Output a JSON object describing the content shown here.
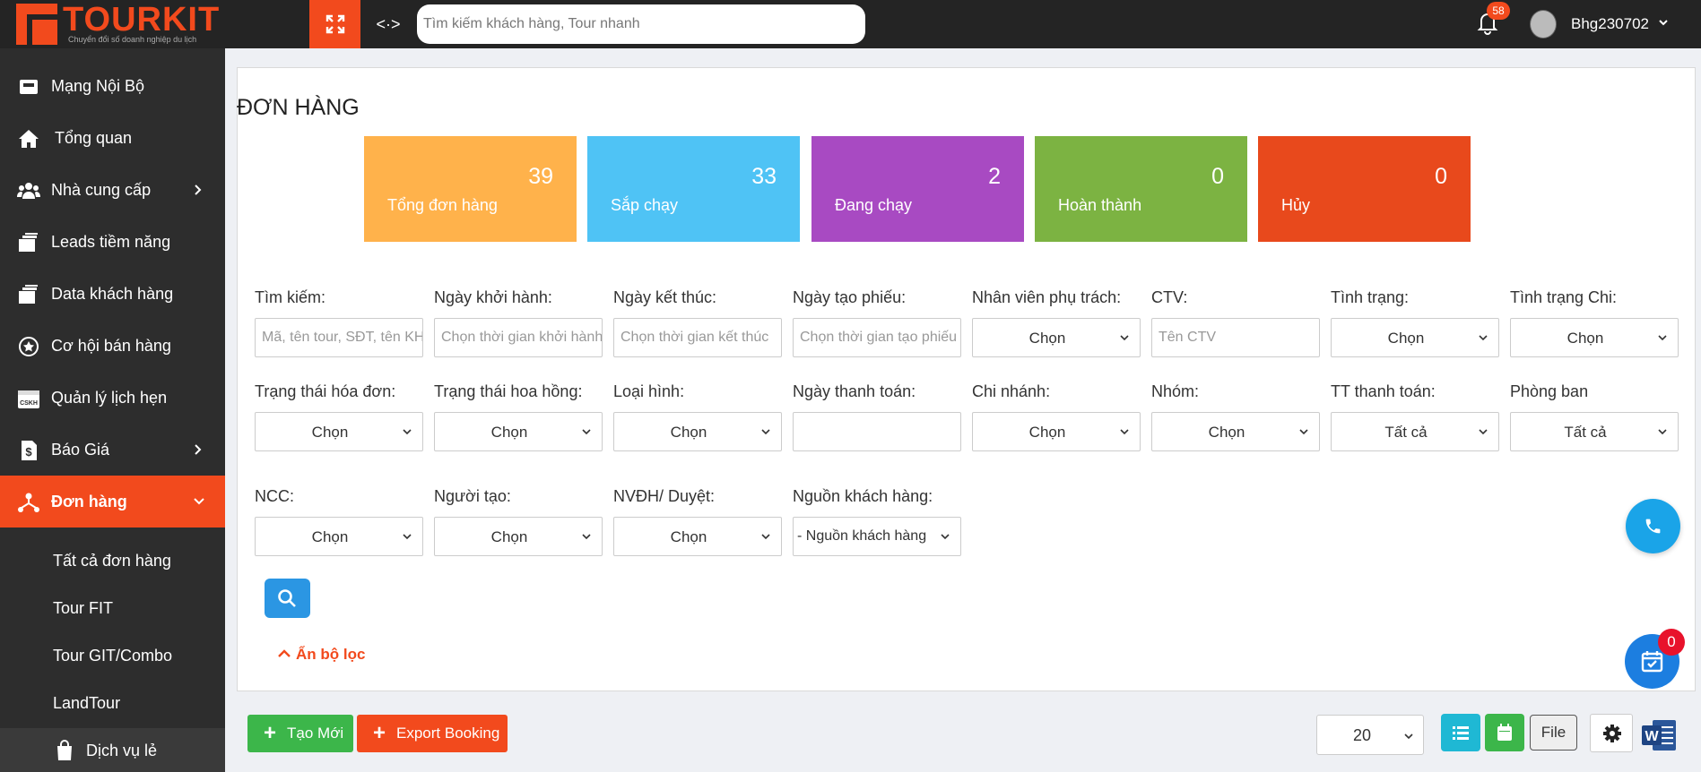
{
  "brand": {
    "name": "TOURKIT",
    "tagline": "Chuyển đổi số doanh nghiệp du lịch",
    "color": "#f24a1d"
  },
  "header": {
    "search_placeholder": "Tìm kiếm khách hàng, Tour nhanh",
    "notification_count": "58",
    "user_name": "Bhg230702",
    "expand_icon": "expand-icon",
    "swap_icon": "arrows-left-right-icon"
  },
  "sidebar": {
    "items": [
      {
        "label": "Mạng Nội Bộ",
        "icon": "inbox-icon"
      },
      {
        "label": "Tổng quan",
        "icon": "home-icon"
      },
      {
        "label": "Nhà cung cấp",
        "icon": "users-icon"
      },
      {
        "label": "Leads tiềm năng",
        "icon": "stack-icon"
      },
      {
        "label": "Data khách hàng",
        "icon": "stack-icon"
      },
      {
        "label": "Cơ hội bán hàng",
        "icon": "star-circle-icon"
      },
      {
        "label": "Quản lý lịch hẹn",
        "icon": "calendar-cskh-icon"
      },
      {
        "label": "Báo Giá",
        "icon": "dollar-doc-icon"
      },
      {
        "label": "Đơn hàng",
        "icon": "network-icon"
      }
    ],
    "sub_items": [
      {
        "label": "Tất cả đơn hàng"
      },
      {
        "label": "Tour FIT"
      },
      {
        "label": "Tour GIT/Combo"
      },
      {
        "label": "LandTour"
      },
      {
        "label": "Dịch vụ lẻ"
      }
    ]
  },
  "page": {
    "title": "ĐƠN HÀNG"
  },
  "stats": [
    {
      "value": "39",
      "label": "Tổng đơn hàng",
      "color": "#ffb24b"
    },
    {
      "value": "33",
      "label": "Sắp chạy",
      "color": "#4fc3f5"
    },
    {
      "value": "2",
      "label": "Đang chạy",
      "color": "#a84ac2"
    },
    {
      "value": "0",
      "label": "Hoàn thành",
      "color": "#7cb342"
    },
    {
      "value": "0",
      "label": "Hủy",
      "color": "#e8491c"
    }
  ],
  "filters": {
    "row1": [
      {
        "label": "Tìm kiếm:",
        "placeholder": "Mã, tên tour, SĐT, tên KH"
      },
      {
        "label": "Ngày khởi hành:",
        "placeholder": "Chọn thời gian khởi hành"
      },
      {
        "label": "Ngày kết thúc:",
        "placeholder": "Chọn thời gian kết thúc"
      },
      {
        "label": "Ngày tạo phiếu:",
        "placeholder": "Chọn thời gian tạo phiếu"
      },
      {
        "label": "Nhân viên phụ trách:",
        "value": "Chọn"
      },
      {
        "label": "CTV:",
        "placeholder": "Tên CTV"
      },
      {
        "label": "Tình trạng:",
        "value": "Chọn"
      },
      {
        "label": "Tình trạng Chi:",
        "value": "Chọn"
      }
    ],
    "row2": [
      {
        "label": "Trạng thái hóa đơn:",
        "value": "Chọn"
      },
      {
        "label": "Trạng thái hoa hồng:",
        "value": "Chọn"
      },
      {
        "label": "Loại hình:",
        "value": "Chọn"
      },
      {
        "label": "Ngày thanh toán:",
        "value": ""
      },
      {
        "label": "Chi nhánh:",
        "value": "Chọn"
      },
      {
        "label": "Nhóm:",
        "value": "Chọn"
      },
      {
        "label": "TT thanh toán:",
        "value": "Tất cả"
      },
      {
        "label": "Phòng ban",
        "value": "Tất cả"
      }
    ],
    "row3": [
      {
        "label": "NCC:",
        "value": "Chọn"
      },
      {
        "label": "Người tạo:",
        "value": "Chọn"
      },
      {
        "label": "NVĐH/ Duyệt:",
        "value": "Chọn"
      },
      {
        "label": "Nguồn khách hàng:",
        "value": "- Nguồn khách hàng"
      }
    ],
    "hide_label": "Ẩn bộ lọc"
  },
  "actions": {
    "new_label": "Tạo Mới",
    "export_label": "Export Booking",
    "page_size": "20",
    "file_label": "File",
    "calendar_badge": "0"
  }
}
